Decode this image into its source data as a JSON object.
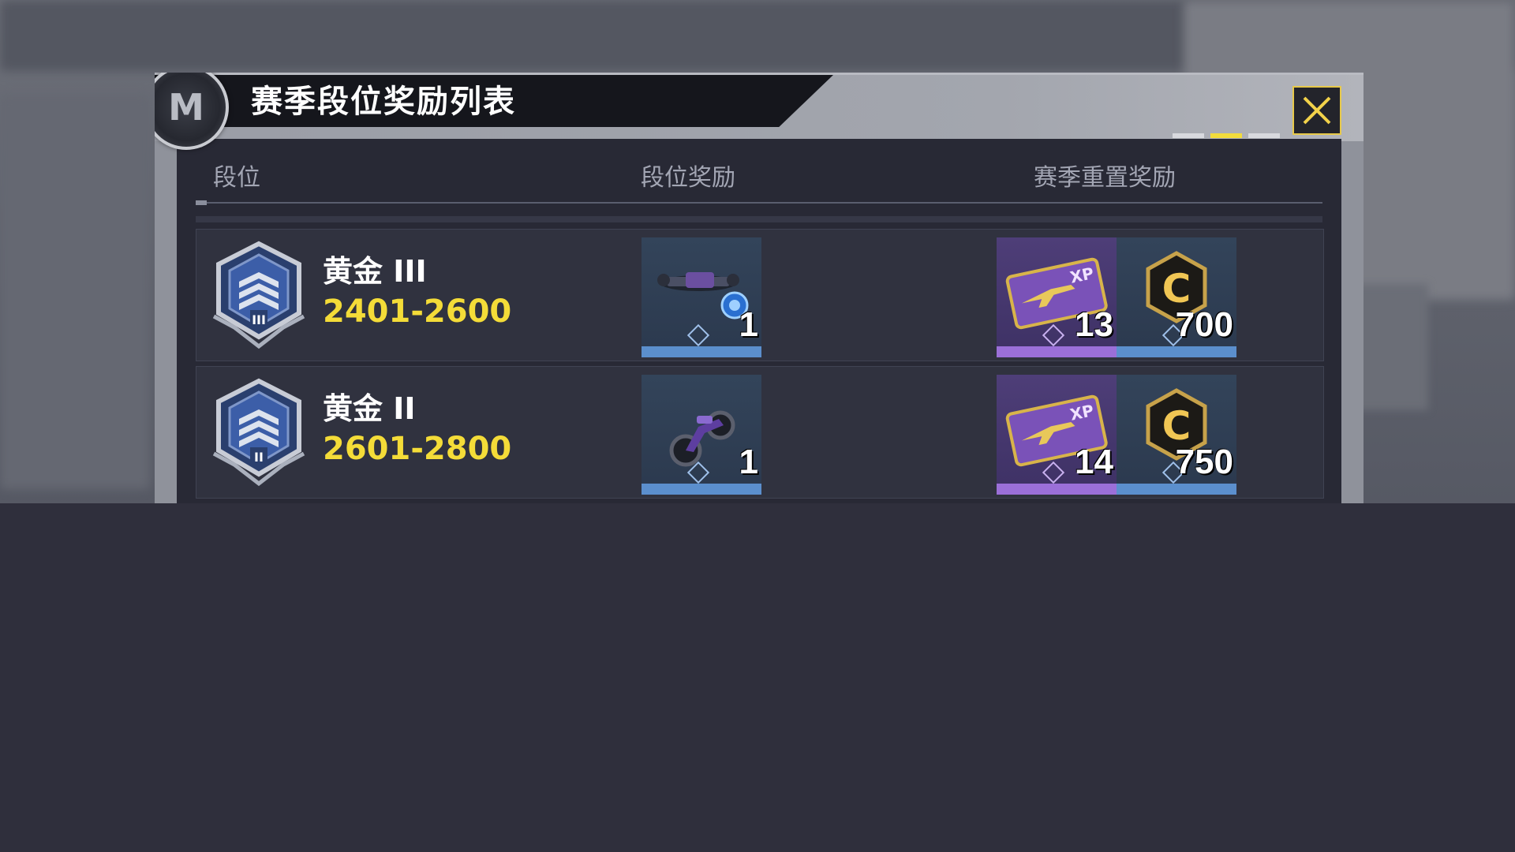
{
  "dialog": {
    "title": "赛季段位奖励列表",
    "logo_icon": "m-logo-icon",
    "close_icon": "close-x-icon",
    "pager": {
      "total": 3,
      "active": 2
    }
  },
  "table": {
    "headers": {
      "rank": "段位",
      "rank_reward": "段位奖励",
      "season_reset_reward": "赛季重置奖励"
    },
    "rows": [
      {
        "rank_name": "黄金 III",
        "rank_range": "2401-2600",
        "rank_icon": "gold-rank-iii-badge-icon",
        "rank_reward": {
          "icon": "drone-skin-icon",
          "count": "1"
        },
        "reset_rewards": [
          {
            "icon": "weapon-xp-card-icon",
            "count": "13"
          },
          {
            "icon": "cod-credit-coin-icon",
            "count": "700"
          }
        ]
      },
      {
        "rank_name": "黄金 II",
        "rank_range": "2601-2800",
        "rank_icon": "gold-rank-ii-badge-icon",
        "rank_reward": {
          "icon": "motorcycle-skin-icon",
          "count": "1"
        },
        "reset_rewards": [
          {
            "icon": "weapon-xp-card-icon",
            "count": "14"
          },
          {
            "icon": "cod-credit-coin-icon",
            "count": "750"
          }
        ]
      }
    ]
  },
  "colors": {
    "accent_yellow": "#f4dc38",
    "rarity_blue": "#5b8fcd",
    "rarity_purple": "#9b6fd8",
    "panel_bg": "#282935"
  }
}
